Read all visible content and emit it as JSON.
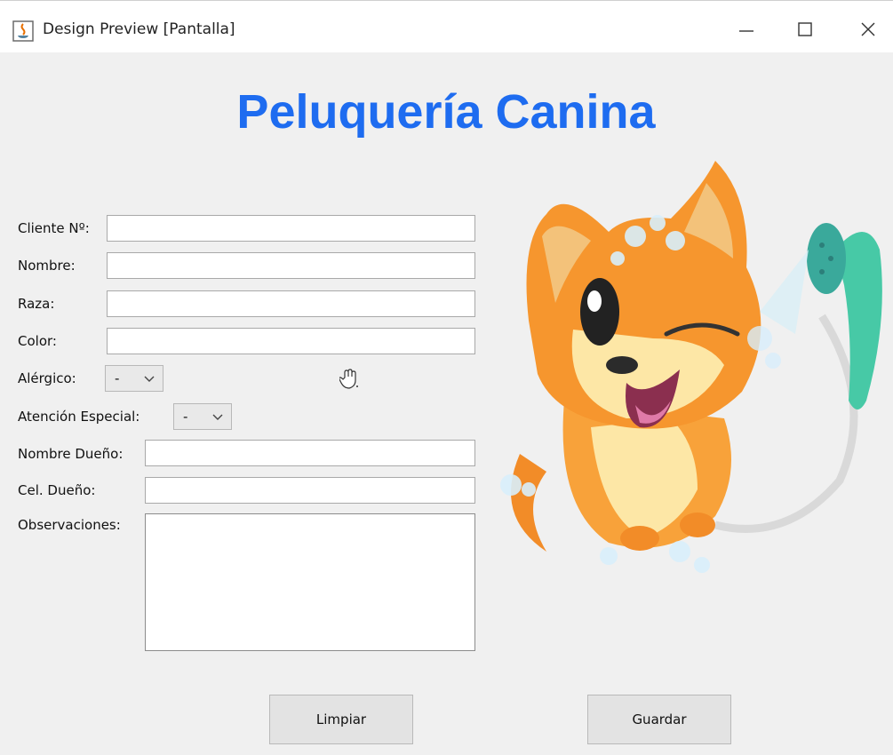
{
  "window": {
    "title": "Design Preview [Pantalla]",
    "controls": {
      "minimize": "—",
      "maximize": "☐",
      "close": "✕"
    }
  },
  "header": {
    "title": "Peluquería Canina"
  },
  "form": {
    "cliente_label": "Cliente Nº:",
    "nombre_label": "Nombre:",
    "raza_label": "Raza:",
    "color_label": "Color:",
    "alergico_label": "Alérgico:",
    "alergico_value": "-",
    "atencion_label": "Atención Especial:",
    "atencion_value": "-",
    "nombre_dueno_label": "Nombre Dueño:",
    "cel_dueno_label": "Cel. Dueño:",
    "observaciones_label": "Observaciones:"
  },
  "buttons": {
    "limpiar": "Limpiar",
    "guardar": "Guardar"
  },
  "colors": {
    "title_blue": "#1e6cf0",
    "window_bg": "#f0f0f0"
  },
  "icons": [
    "java-app-icon",
    "chevron-down-icon",
    "hand-cursor-icon",
    "dog-mascot-image",
    "shower-head-icon"
  ]
}
